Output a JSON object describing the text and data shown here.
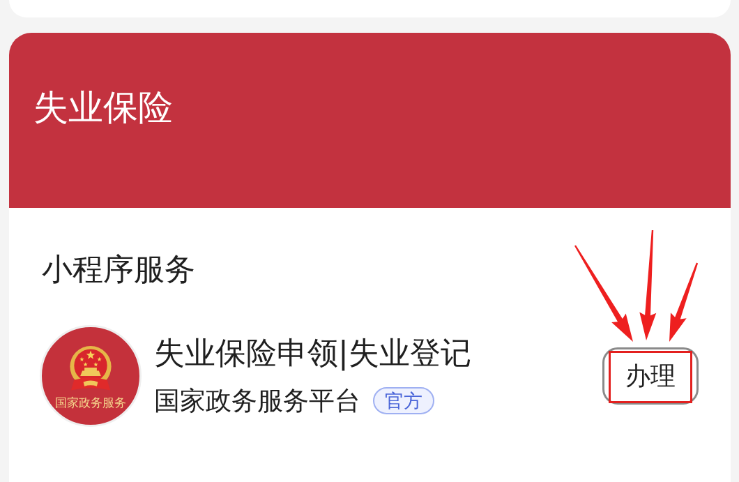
{
  "section": {
    "title": "失业保险",
    "heading": "小程序服务",
    "service": {
      "logo_text": "国家政务服务",
      "name": "失业保险申领|失业登记",
      "provider": "国家政务服务平台",
      "badge": "官方",
      "action": {
        "label": "办理",
        "highlighted": true
      }
    }
  }
}
